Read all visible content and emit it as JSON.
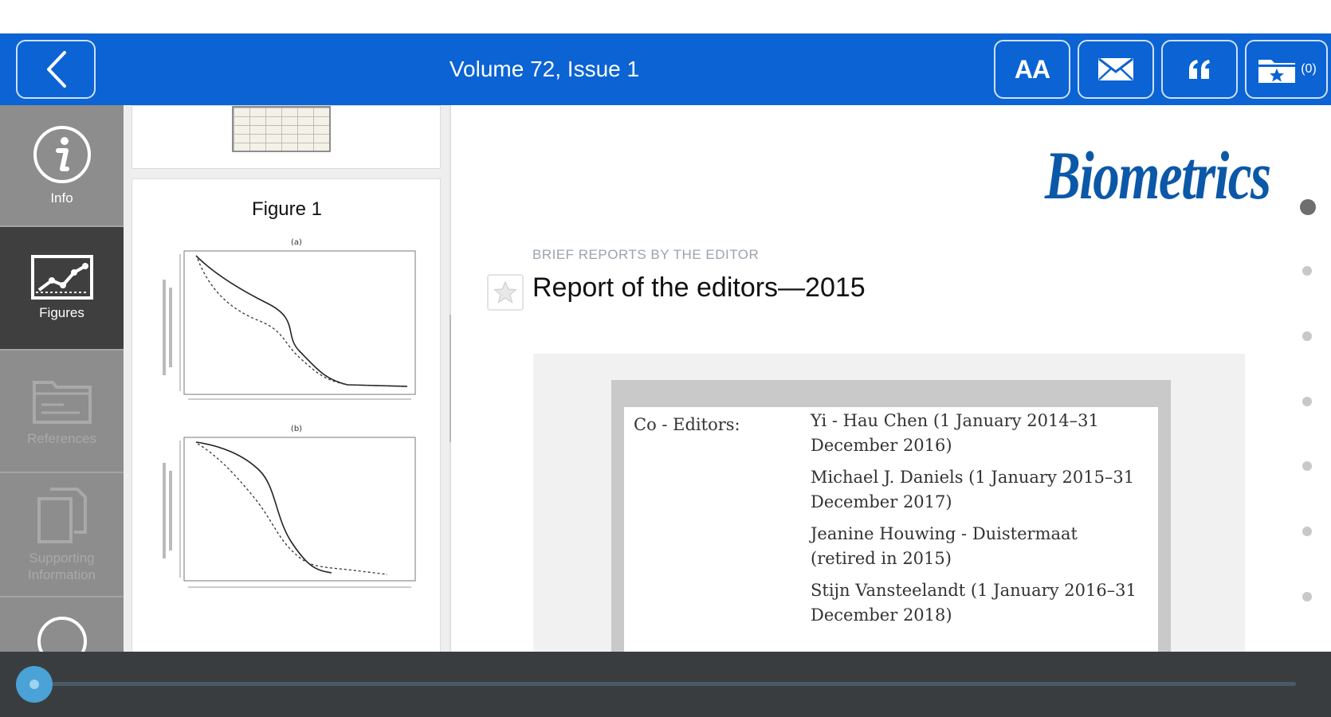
{
  "header": {
    "title": "Volume 72, Issue 1",
    "font_button_label": "AA",
    "saved_count": "(0)",
    "bar_color": "#0b63d4"
  },
  "sidebar": {
    "items": [
      {
        "label": "Info",
        "icon": "info-icon",
        "selected": false,
        "enabled": true
      },
      {
        "label": "Figures",
        "icon": "chart-icon",
        "selected": true,
        "enabled": true
      },
      {
        "label": "References",
        "icon": "folder-icon",
        "selected": false,
        "enabled": false
      },
      {
        "label": "Supporting Information",
        "icon": "documents-icon",
        "selected": false,
        "enabled": false
      },
      {
        "label": "",
        "icon": "circle-icon",
        "selected": false,
        "enabled": true
      }
    ]
  },
  "figures_panel": {
    "figure_title": "Figure 1",
    "panel_a_label": "(a)",
    "panel_b_label": "(b)"
  },
  "article": {
    "journal": "Biometrics",
    "section": "BRIEF REPORTS BY THE EDITOR",
    "title": "Report of the editors—2015",
    "co_editors_label": "Co - Editors:",
    "co_editors": [
      "Yi - Hau Chen (1 January 2014–31 December 2016)",
      "Michael J. Daniels (1 January 2015–31 December 2017)",
      "Jeanine Houwing - Duistermaat (retired in 2015)",
      "Stijn Vansteelandt (1 January 2016–31 December 2018)"
    ],
    "brand_color": "#0c58a8"
  },
  "pager": {
    "page_count": 7,
    "current_page": 1
  },
  "scrubber": {
    "progress": 0.0,
    "accent": "#4aa2d6"
  }
}
